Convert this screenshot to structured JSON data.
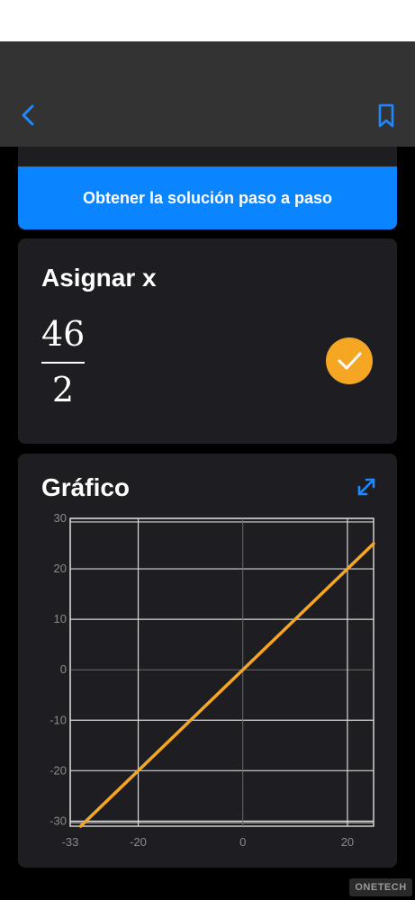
{
  "toolbar": {
    "back_icon": "chevron-left-icon",
    "bookmark_icon": "bookmark-icon"
  },
  "solution_button": {
    "label": "Obtener la solución paso a paso"
  },
  "assign_card": {
    "title": "Asignar x",
    "numerator": "46",
    "denominator": "2",
    "status_icon": "checkmark-icon"
  },
  "graph_card": {
    "title": "Gráfico",
    "expand_icon": "expand-icon",
    "chart_data": {
      "type": "line",
      "title": "Gráfico",
      "xlabel": "",
      "ylabel": "",
      "x_ticks": [
        "-33",
        "-20",
        "0",
        "20"
      ],
      "y_ticks": [
        "30",
        "20",
        "10",
        "0",
        "-10",
        "-20",
        "-30"
      ],
      "xlim": [
        -33,
        25
      ],
      "ylim": [
        -31,
        30
      ],
      "grid": true,
      "series": [
        {
          "color": "#f5a623",
          "x": [
            -31,
            25
          ],
          "y": [
            -31,
            25
          ]
        }
      ]
    }
  },
  "watermark": {
    "text": "ONETECH"
  },
  "colors": {
    "accent": "#0a84ff",
    "success": "#f5a623",
    "card": "#1e1e22"
  }
}
